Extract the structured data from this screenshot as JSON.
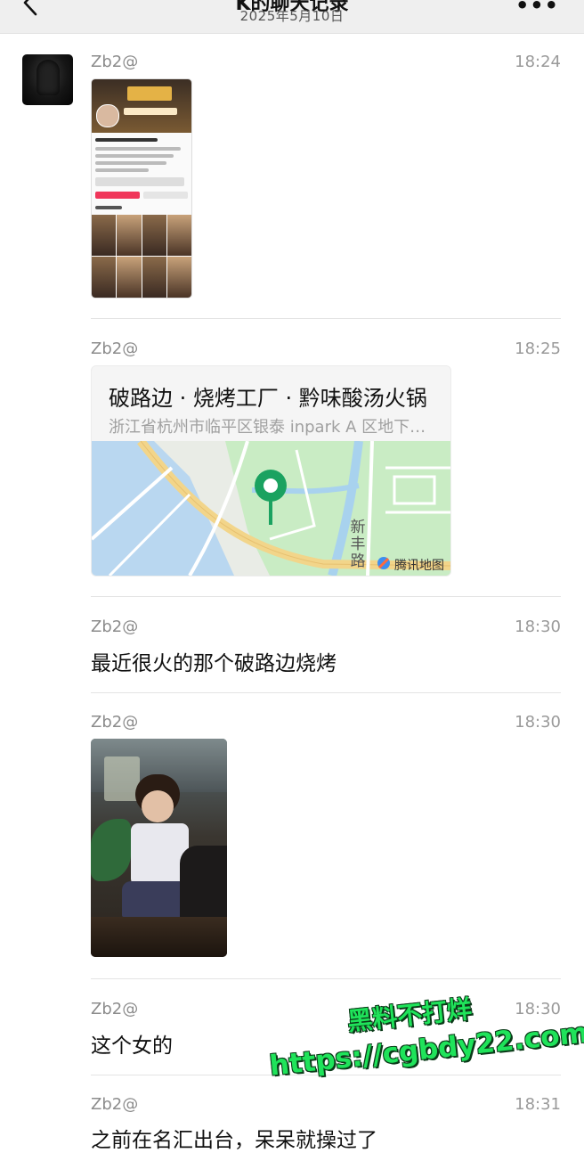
{
  "header": {
    "title": "K的聊天记录",
    "subtitle": "2025年5月10日"
  },
  "messages": [
    {
      "sender": "Zb2@",
      "time": "18:24",
      "type": "image"
    },
    {
      "sender": "Zb2@",
      "time": "18:25",
      "type": "location",
      "location": {
        "name": "破路边 · 烧烤工厂 · 黔味酸汤火锅",
        "address": "浙江省杭州市临平区银泰 inpark A 区地下一层",
        "map_road_label": "新丰路",
        "map_provider": "腾讯地图"
      }
    },
    {
      "sender": "Zb2@",
      "time": "18:30",
      "type": "text",
      "text": "最近很火的那个破路边烧烤"
    },
    {
      "sender": "Zb2@",
      "time": "18:30",
      "type": "image"
    },
    {
      "sender": "Zb2@",
      "time": "18:30",
      "type": "text",
      "text": "这个女的"
    },
    {
      "sender": "Zb2@",
      "time": "18:31",
      "type": "text",
      "text": "之前在名汇出台，呆呆就操过了"
    }
  ],
  "watermark": {
    "line1": "黑料不打烊",
    "line2": "https://cgbdy22.com"
  },
  "colors": {
    "header_bg": "#efefef",
    "map_pin": "#1aa260",
    "watermark": "#1fe35a"
  }
}
